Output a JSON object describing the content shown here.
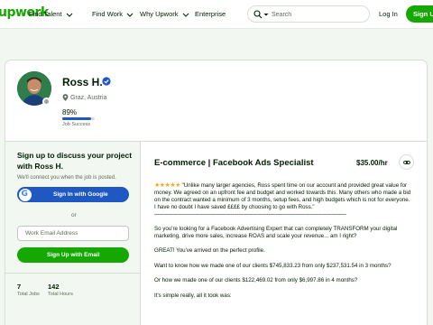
{
  "header": {
    "logo": "upwork",
    "nav": [
      {
        "label": "Find Talent"
      },
      {
        "label": "Find Work"
      },
      {
        "label": "Why Upwork"
      },
      {
        "label": "Enterprise"
      }
    ],
    "search_placeholder": "Search",
    "login": "Log In",
    "signup": "Sign Up"
  },
  "profile": {
    "name": "Ross H.",
    "location": "Graz, Austria",
    "job_success_value": "89%",
    "job_success_fraction": 0.89,
    "job_success_label": "Job Success"
  },
  "signup_panel": {
    "title": "Sign up to discuss your project with Ross H.",
    "subtitle": "We'll connect you when the job is posted.",
    "google_button": "Sign In with Google",
    "or": "or",
    "email_placeholder": "Work Email Address",
    "email_button": "Sign Up with Email"
  },
  "stats": {
    "total_jobs_value": "7",
    "total_jobs_label": "Total Jobs",
    "total_hours_value": "142",
    "total_hours_label": "Total Hours"
  },
  "job": {
    "title": "E-commerce | Facebook Ads Specialist",
    "rate": "$35.00/hr",
    "stars": "★★★★★",
    "review": "\"Unlike many larger agencies, Ross spent time on our account and provided great value for money. We agreed on an upfront fee and budget and worked towards this. Many others who made a bid on the contract wanted a minimum of 3 months, setup fees, and high budgets which is not for everyone. I have no doubt I have saved ££££ by choosing to go with Ross.\"",
    "separator": "--------------------------------------------------------------------------------------------------------------------------------",
    "paragraphs": [
      "So you're looking for a Facebook Advertising Expert that can completely TRANSFORM your digital marketing, drive more sales, increase ROAS and scale your revenue... am I right?",
      "GREAT! You've arrived on the perfect profile.",
      "Want to know how we made one of our clients $745,833.23 from only $237,531.54 in 3 months?",
      "Or how we made one of our clients $122,469.02 from only $6,997.86 in 4 months?",
      "It's simple really, all it took was:"
    ]
  },
  "colors": {
    "brand_green": "#14a800",
    "google_blue": "#1f57c3",
    "star_orange": "#ffa41b"
  }
}
